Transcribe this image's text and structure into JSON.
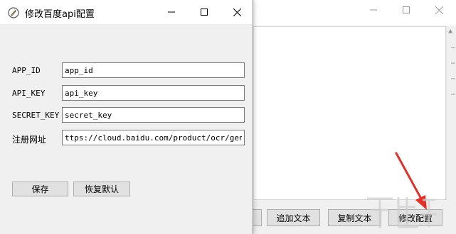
{
  "background_window": {
    "buttons": {
      "add_text": "追加文本",
      "copy_text": "复制文本",
      "modify_config": "修改配置"
    }
  },
  "dialog": {
    "title": "修改百度api配置",
    "fields": [
      {
        "label": "APP_ID",
        "value": "app_id"
      },
      {
        "label": "API_KEY",
        "value": "api_key"
      },
      {
        "label": "SECRET_KEY",
        "value": "secret_key"
      },
      {
        "label": "注册网址",
        "value": "ttps://cloud.baidu.com/product/ocr/general"
      }
    ],
    "save_label": "保存",
    "restore_label": "恢复默认"
  },
  "colors": {
    "arrow": "#e0302a",
    "window_bg": "#f0f0f0",
    "button_bg": "#e1e1e1",
    "button_border": "#adadad"
  },
  "icons": {
    "app": "pencil-circle-icon",
    "minimize": "minimize-icon",
    "maximize": "maximize-icon",
    "close": "close-icon"
  }
}
